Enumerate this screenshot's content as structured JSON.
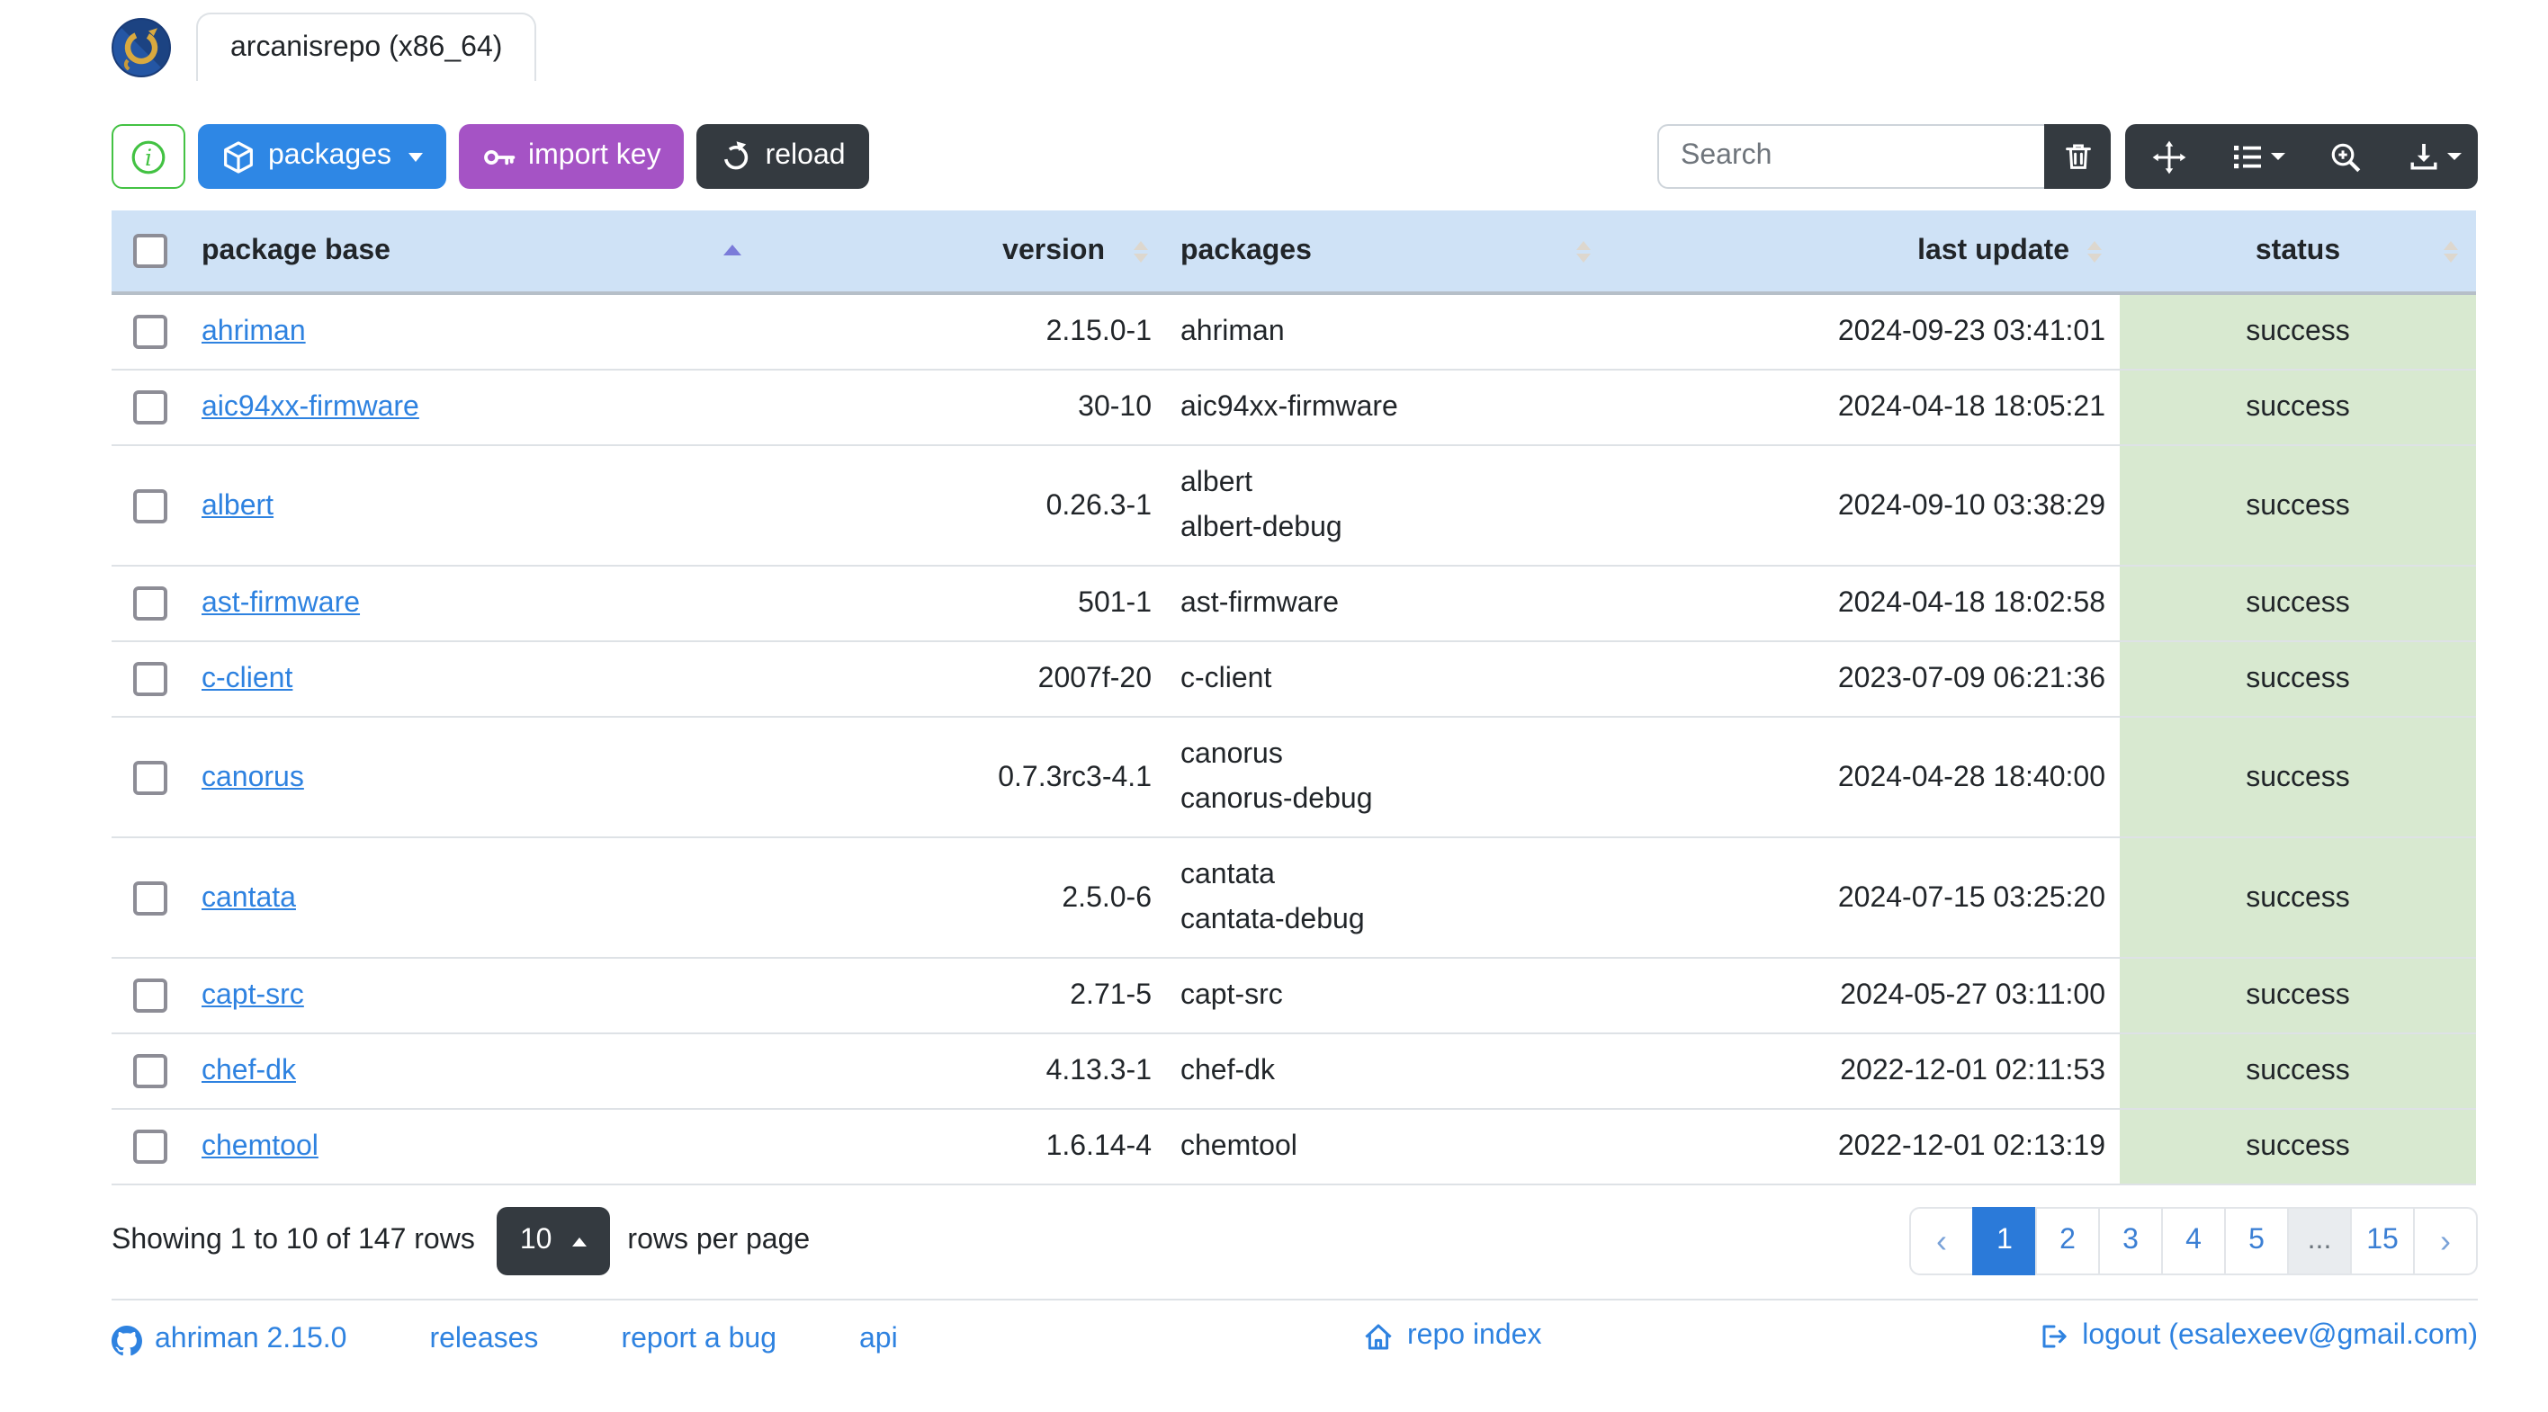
{
  "header": {
    "tab_title": "arcanisrepo (x86_64)"
  },
  "toolbar": {
    "packages_label": "packages",
    "import_key_label": "import key",
    "reload_label": "reload",
    "search_placeholder": "Search"
  },
  "table": {
    "columns": [
      {
        "label": "",
        "type": "checkbox"
      },
      {
        "label": "package base",
        "sortable": true,
        "sorted": "asc"
      },
      {
        "label": "version",
        "sortable": true
      },
      {
        "label": "packages",
        "sortable": true
      },
      {
        "label": "last update",
        "sortable": true
      },
      {
        "label": "status",
        "sortable": true
      }
    ],
    "rows": [
      {
        "base": "ahriman",
        "version": "2.15.0-1",
        "packages": [
          "ahriman"
        ],
        "last_update": "2024-09-23 03:41:01",
        "status": "success"
      },
      {
        "base": "aic94xx-firmware",
        "version": "30-10",
        "packages": [
          "aic94xx-firmware"
        ],
        "last_update": "2024-04-18 18:05:21",
        "status": "success"
      },
      {
        "base": "albert",
        "version": "0.26.3-1",
        "packages": [
          "albert",
          "albert-debug"
        ],
        "last_update": "2024-09-10 03:38:29",
        "status": "success"
      },
      {
        "base": "ast-firmware",
        "version": "501-1",
        "packages": [
          "ast-firmware"
        ],
        "last_update": "2024-04-18 18:02:58",
        "status": "success"
      },
      {
        "base": "c-client",
        "version": "2007f-20",
        "packages": [
          "c-client"
        ],
        "last_update": "2023-07-09 06:21:36",
        "status": "success"
      },
      {
        "base": "canorus",
        "version": "0.7.3rc3-4.1",
        "packages": [
          "canorus",
          "canorus-debug"
        ],
        "last_update": "2024-04-28 18:40:00",
        "status": "success"
      },
      {
        "base": "cantata",
        "version": "2.5.0-6",
        "packages": [
          "cantata",
          "cantata-debug"
        ],
        "last_update": "2024-07-15 03:25:20",
        "status": "success"
      },
      {
        "base": "capt-src",
        "version": "2.71-5",
        "packages": [
          "capt-src"
        ],
        "last_update": "2024-05-27 03:11:00",
        "status": "success"
      },
      {
        "base": "chef-dk",
        "version": "4.13.3-1",
        "packages": [
          "chef-dk"
        ],
        "last_update": "2022-12-01 02:11:53",
        "status": "success"
      },
      {
        "base": "chemtool",
        "version": "1.6.14-4",
        "packages": [
          "chemtool"
        ],
        "last_update": "2022-12-01 02:13:19",
        "status": "success"
      }
    ]
  },
  "pagination": {
    "summary": "Showing 1 to 10 of 147 rows",
    "page_size": "10",
    "rows_per_page_label": "rows per page",
    "prev": "‹",
    "next": "›",
    "pages": [
      "1",
      "2",
      "3",
      "4",
      "5",
      "...",
      "15"
    ],
    "active_page": "1"
  },
  "footer": {
    "links": [
      "ahriman 2.15.0",
      "releases",
      "report a bug",
      "api"
    ],
    "repo_index_label": "repo index",
    "logout_label": "logout (esalexeev@gmail.com)"
  },
  "colors": {
    "primary": "#2e87e5",
    "purple": "#a553c5",
    "dark": "#343a40",
    "info_green": "#43c243",
    "link": "#2e82e0",
    "header_bg": "#cfe2f6",
    "success_bg": "#d8e9d0",
    "active_page": "#2b7ad9",
    "sort_active": "#7b7bd9"
  }
}
